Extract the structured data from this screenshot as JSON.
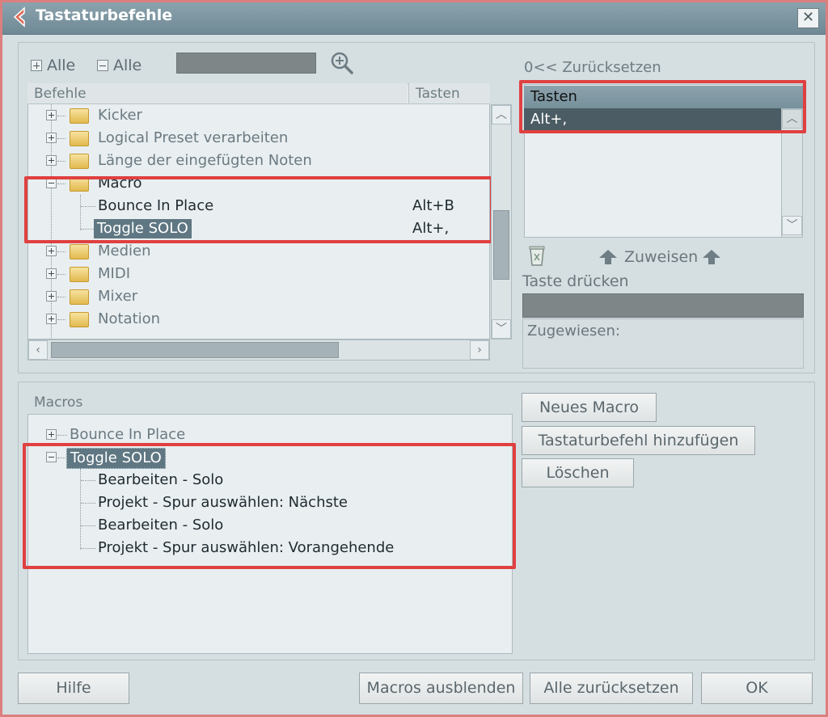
{
  "window": {
    "title": "Tastaturbefehle",
    "close_glyph": "✕"
  },
  "toolbar": {
    "expand_all": "Alle",
    "collapse_all": "Alle",
    "zoom_icon": "zoom-in-icon"
  },
  "commands_table": {
    "col_commands": "Befehle",
    "col_keys": "Tasten",
    "rows": [
      {
        "label": "Kicker",
        "key": ""
      },
      {
        "label": "Logical Preset verarbeiten",
        "key": ""
      },
      {
        "label": "Länge der eingefügten Noten",
        "key": ""
      },
      {
        "label": "Macro",
        "key": ""
      },
      {
        "label": "Bounce In Place",
        "key": "Alt+B"
      },
      {
        "label": "Toggle SOLO",
        "key": "Alt+,"
      },
      {
        "label": "Medien",
        "key": ""
      },
      {
        "label": "MIDI",
        "key": ""
      },
      {
        "label": "Mixer",
        "key": ""
      },
      {
        "label": "Notation",
        "key": ""
      }
    ]
  },
  "keys_panel": {
    "reset_label": "0<< Zurücksetzen",
    "header": "Tasten",
    "value": "Alt+,",
    "assign_label": "Zuweisen",
    "press_key_label": "Taste drücken",
    "assigned_label": "Zugewiesen:"
  },
  "macros": {
    "title": "Macros",
    "items": [
      {
        "label": "Bounce In Place"
      },
      {
        "label": "Toggle SOLO"
      }
    ],
    "children": [
      "Bearbeiten - Solo",
      "Projekt - Spur auswählen: Nächste",
      "Bearbeiten - Solo",
      "Projekt - Spur auswählen: Vorangehende"
    ],
    "buttons": {
      "new_macro": "Neues Macro",
      "add_command": "Tastaturbefehl hinzufügen",
      "delete": "Löschen"
    }
  },
  "footer": {
    "help": "Hilfe",
    "hide_macros": "Macros ausblenden",
    "reset_all": "Alle zurücksetzen",
    "ok": "OK"
  },
  "colors": {
    "highlight_box": "#e04040",
    "title_bar": "#7a93a0"
  }
}
